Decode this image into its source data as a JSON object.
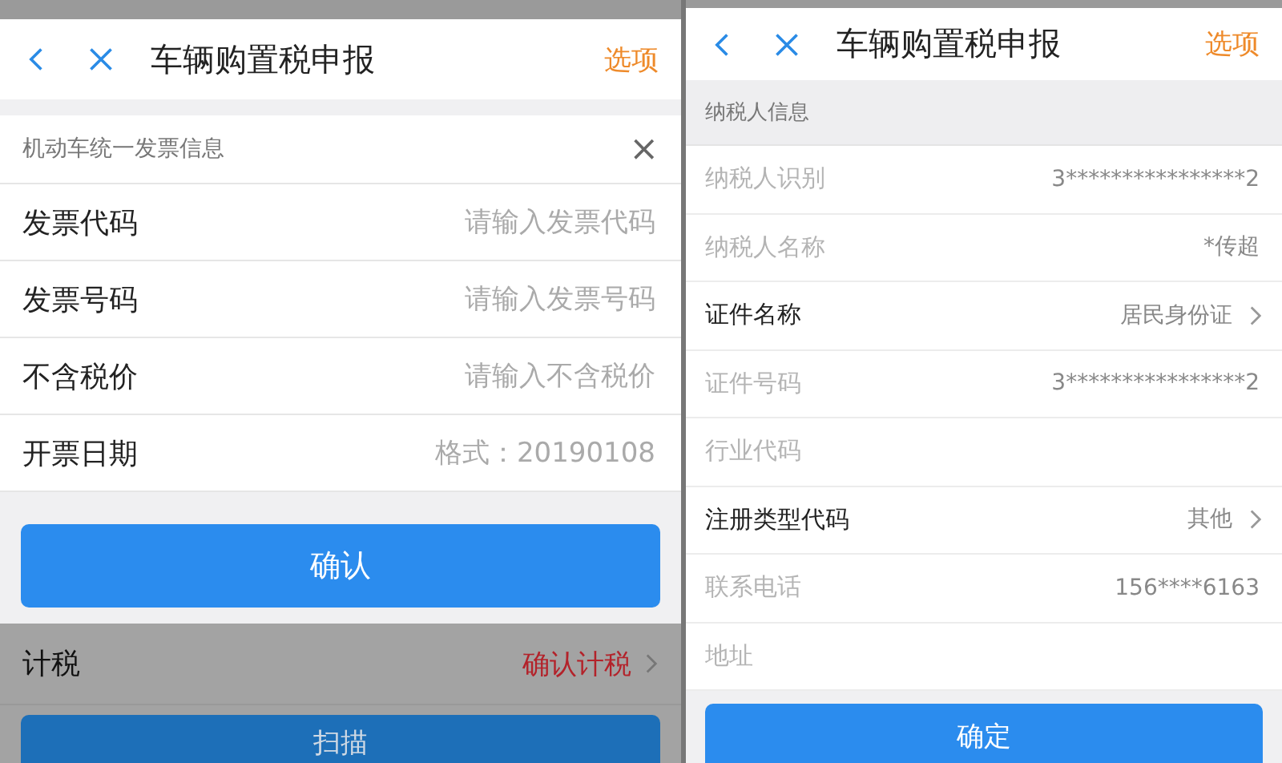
{
  "left": {
    "header": {
      "title": "车辆购置税申报",
      "action": "选项"
    },
    "section": {
      "title": "机动车统一发票信息",
      "close": "×"
    },
    "fields": [
      {
        "label": "发票代码",
        "placeholder": "请输入发票代码"
      },
      {
        "label": "发票号码",
        "placeholder": "请输入发票号码"
      },
      {
        "label": "不含税价",
        "placeholder": "请输入不含税价"
      },
      {
        "label": "开票日期",
        "placeholder": "格式：20190108"
      }
    ],
    "confirm_button": "确认",
    "behind": {
      "dimmed": true,
      "row": {
        "label": "计税",
        "value": "确认计税"
      },
      "button": "扫描"
    }
  },
  "right": {
    "header": {
      "title": "车辆购置税申报",
      "action": "选项"
    },
    "section": {
      "title": "纳税人信息"
    },
    "rows": [
      {
        "label": "纳税人识别",
        "value": "3****************2",
        "disabled": true,
        "arrow": false
      },
      {
        "label": "纳税人名称",
        "value": "*传超",
        "disabled": true,
        "arrow": false
      },
      {
        "label": "证件名称",
        "value": "居民身份证",
        "disabled": false,
        "arrow": true
      },
      {
        "label": "证件号码",
        "value": "3****************2",
        "disabled": true,
        "arrow": false
      },
      {
        "label": "行业代码",
        "value": "",
        "disabled": true,
        "arrow": false
      },
      {
        "label": "注册类型代码",
        "value": "其他",
        "disabled": false,
        "arrow": true
      },
      {
        "label": "联系电话",
        "value": "156****6163",
        "disabled": true,
        "arrow": false
      },
      {
        "label": "地址",
        "value": "",
        "disabled": true,
        "arrow": false
      }
    ],
    "confirm_button": "确定"
  }
}
